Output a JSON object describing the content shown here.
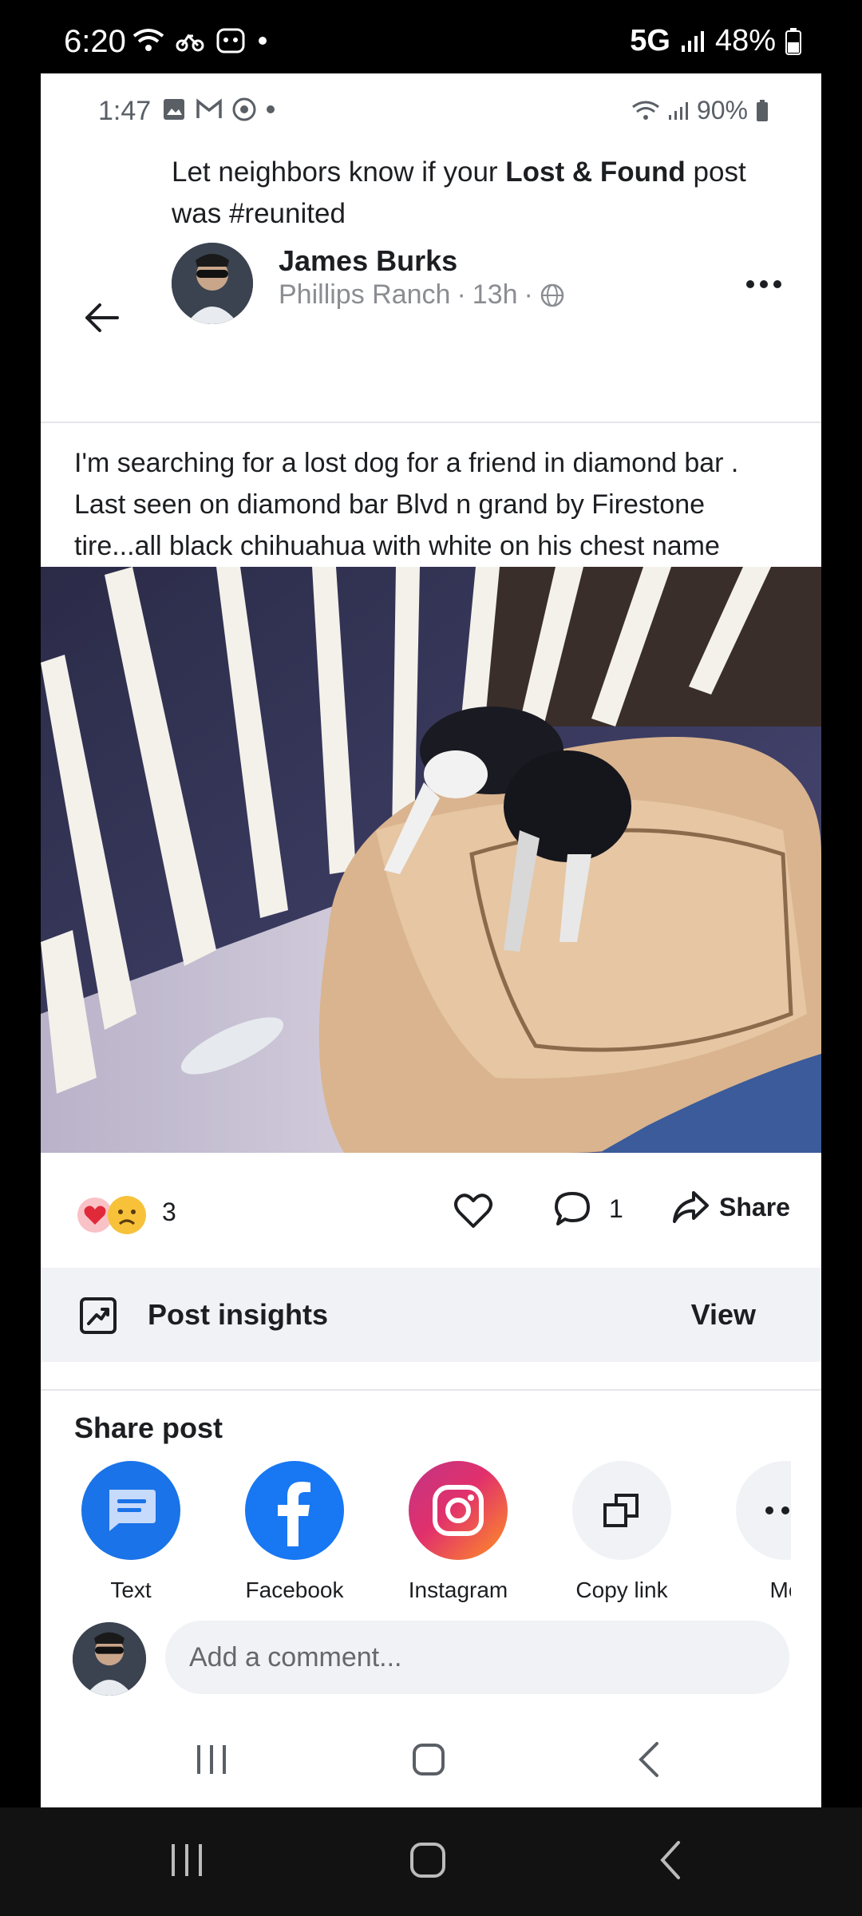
{
  "outer_status": {
    "time": "6:20",
    "network": "5G",
    "battery": "48%"
  },
  "inner_status": {
    "time": "1:47",
    "battery": "90%"
  },
  "post": {
    "banner_prefix": "Let neighbors know if your ",
    "banner_bold": "Lost & Found",
    "banner_suffix": " post was #reunited",
    "author": "James Burks",
    "location": "Phillips Ranch",
    "age": "13h",
    "body": "I'm searching for a lost dog for a friend in diamond bar . Last seen on diamond bar Blvd  n grand by Firestone tire...all black chihuahua with white on his chest name Gucci",
    "separator": "·"
  },
  "engagement": {
    "reaction_count": "3",
    "comment_count": "1",
    "share_label": "Share"
  },
  "insights": {
    "label": "Post insights",
    "view_label": "View"
  },
  "share": {
    "title": "Share post",
    "targets": [
      {
        "label": "Text",
        "icon": "message-icon",
        "color": "#1a73e8"
      },
      {
        "label": "Facebook",
        "icon": "facebook-icon",
        "color": "#1877f2"
      },
      {
        "label": "Instagram",
        "icon": "instagram-icon",
        "color": "#e1306c"
      },
      {
        "label": "Copy link",
        "icon": "copy-link-icon",
        "color": "#f0f2f5"
      },
      {
        "label": "Mo",
        "icon": "more-icon",
        "color": "#f0f2f5"
      }
    ]
  },
  "comment": {
    "placeholder": "Add a comment..."
  },
  "colors": {
    "panel_bg": "#ffffff",
    "insights_bg": "#f0f2f5",
    "secondary_text": "#8a8d91"
  }
}
